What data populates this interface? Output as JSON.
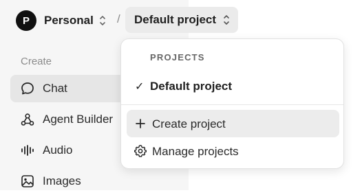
{
  "header": {
    "org_avatar_letter": "P",
    "org_name": "Personal",
    "separator": "/",
    "project_name": "Default project"
  },
  "sidebar": {
    "section_label": "Create",
    "items": [
      {
        "label": "Chat",
        "icon": "chat-icon",
        "active": true
      },
      {
        "label": "Agent Builder",
        "icon": "agent-builder-icon",
        "active": false
      },
      {
        "label": "Audio",
        "icon": "audio-icon",
        "active": false
      },
      {
        "label": "Images",
        "icon": "images-icon",
        "active": false
      }
    ]
  },
  "project_menu": {
    "header": "PROJECTS",
    "check_mark": "✓",
    "selected_project": "Default project",
    "actions": [
      {
        "label": "Create project",
        "icon": "plus-icon"
      },
      {
        "label": "Manage projects",
        "icon": "gear-icon"
      }
    ]
  },
  "colors": {
    "sidebar_bg": "#f6f6f6",
    "active_item_bg": "#e6e6e6",
    "avatar_bg": "#111111"
  }
}
